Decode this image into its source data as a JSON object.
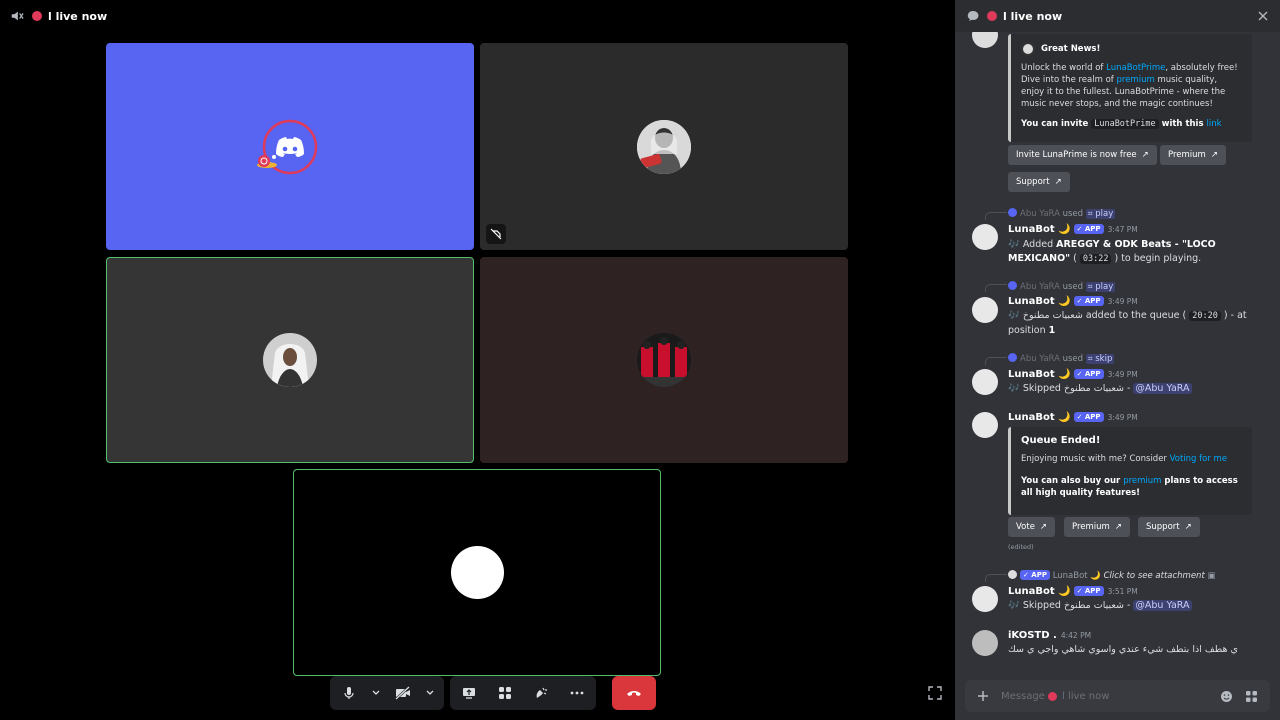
{
  "call": {
    "title": "l live now"
  },
  "chat_header": {
    "title": "l live now"
  },
  "messages": {
    "embed1": {
      "title": "Great News!",
      "body_prefix": "Unlock the world of ",
      "body_link1": "LunaBotPrime",
      "body_mid1": ", absolutely free! Dive into the realm of ",
      "body_link2": "premium",
      "body_rest": " music quality, enjoy it to the fullest. LunaBotPrime - where the music never stops, and the magic continues!",
      "invite_prefix": "You can invite ",
      "invite_code": "LunaBotPrime",
      "invite_mid": " with this ",
      "invite_link": "link"
    },
    "buttons1": [
      "Invite LunaPrime is now free",
      "Premium",
      "Support"
    ],
    "m1": {
      "reply_user": "Abu YaRA",
      "reply_used": "used",
      "reply_cmd": "⌗ play",
      "author": "LunaBot 🌙",
      "badge": "✓ APP",
      "time": "3:47 PM",
      "text_prefix": "🎶 Added ",
      "text_bold": "AREGGY & ODK Beats - \"LOCO MEXICANO\"",
      "text_open": " ( ",
      "text_code": "03:22",
      "text_close": " ) to begin playing."
    },
    "m2": {
      "reply_user": "Abu YaRA",
      "reply_used": "used",
      "reply_cmd": "⌗ play",
      "author": "LunaBot 🌙",
      "badge": "✓ APP",
      "time": "3:49 PM",
      "text_prefix": "🎶 شعبيات مطنوخ",
      "text_mid": " added to the queue ( ",
      "text_code": "20:20",
      "text_suffix": " ) - at",
      "text_line2": "position ",
      "text_pos": "1"
    },
    "m3": {
      "reply_user": "Abu YaRA",
      "reply_used": "used",
      "reply_cmd": "⌗ skip",
      "author": "LunaBot 🌙",
      "badge": "✓ APP",
      "time": "3:49 PM",
      "text": "🎶 Skipped شعبيات مطنوخ - ",
      "mention": "@Abu YaRA"
    },
    "m4": {
      "author": "LunaBot 🌙",
      "badge": "✓ APP",
      "time": "3:49 PM",
      "embed_title": "Queue Ended!",
      "embed_line1_prefix": "Enjoying music with me? Consider ",
      "embed_line1_link": "Voting for me",
      "embed_line2_prefix": "You can also buy our ",
      "embed_line2_link": "premium",
      "embed_line2_rest": " plans to access all high quality features!",
      "edited": "(edited)"
    },
    "buttons2": [
      "Vote",
      "Premium",
      "Support"
    ],
    "m5": {
      "reply_badge": "✓ APP",
      "reply_author": "LunaBot 🌙",
      "reply_text": "Click to see attachment",
      "author": "LunaBot 🌙",
      "badge": "✓ APP",
      "time": "3:51 PM",
      "text": "🎶 Skipped شعبيات مطنوخ - ",
      "mention": "@Abu YaRA"
    },
    "m6": {
      "author": "iKOSTD .",
      "time": "4:42 PM",
      "text": "ي هطف اذا بتطف شيء عندي واسوي شاهي واجي ي سك"
    }
  },
  "composer": {
    "placeholder_prefix": "Message",
    "placeholder_channel": "l live now"
  },
  "colors": {
    "accent": "#5865f2",
    "hangup": "#da373c",
    "speaking": "#4fbf6b",
    "live_dot": "#e03a5a"
  }
}
